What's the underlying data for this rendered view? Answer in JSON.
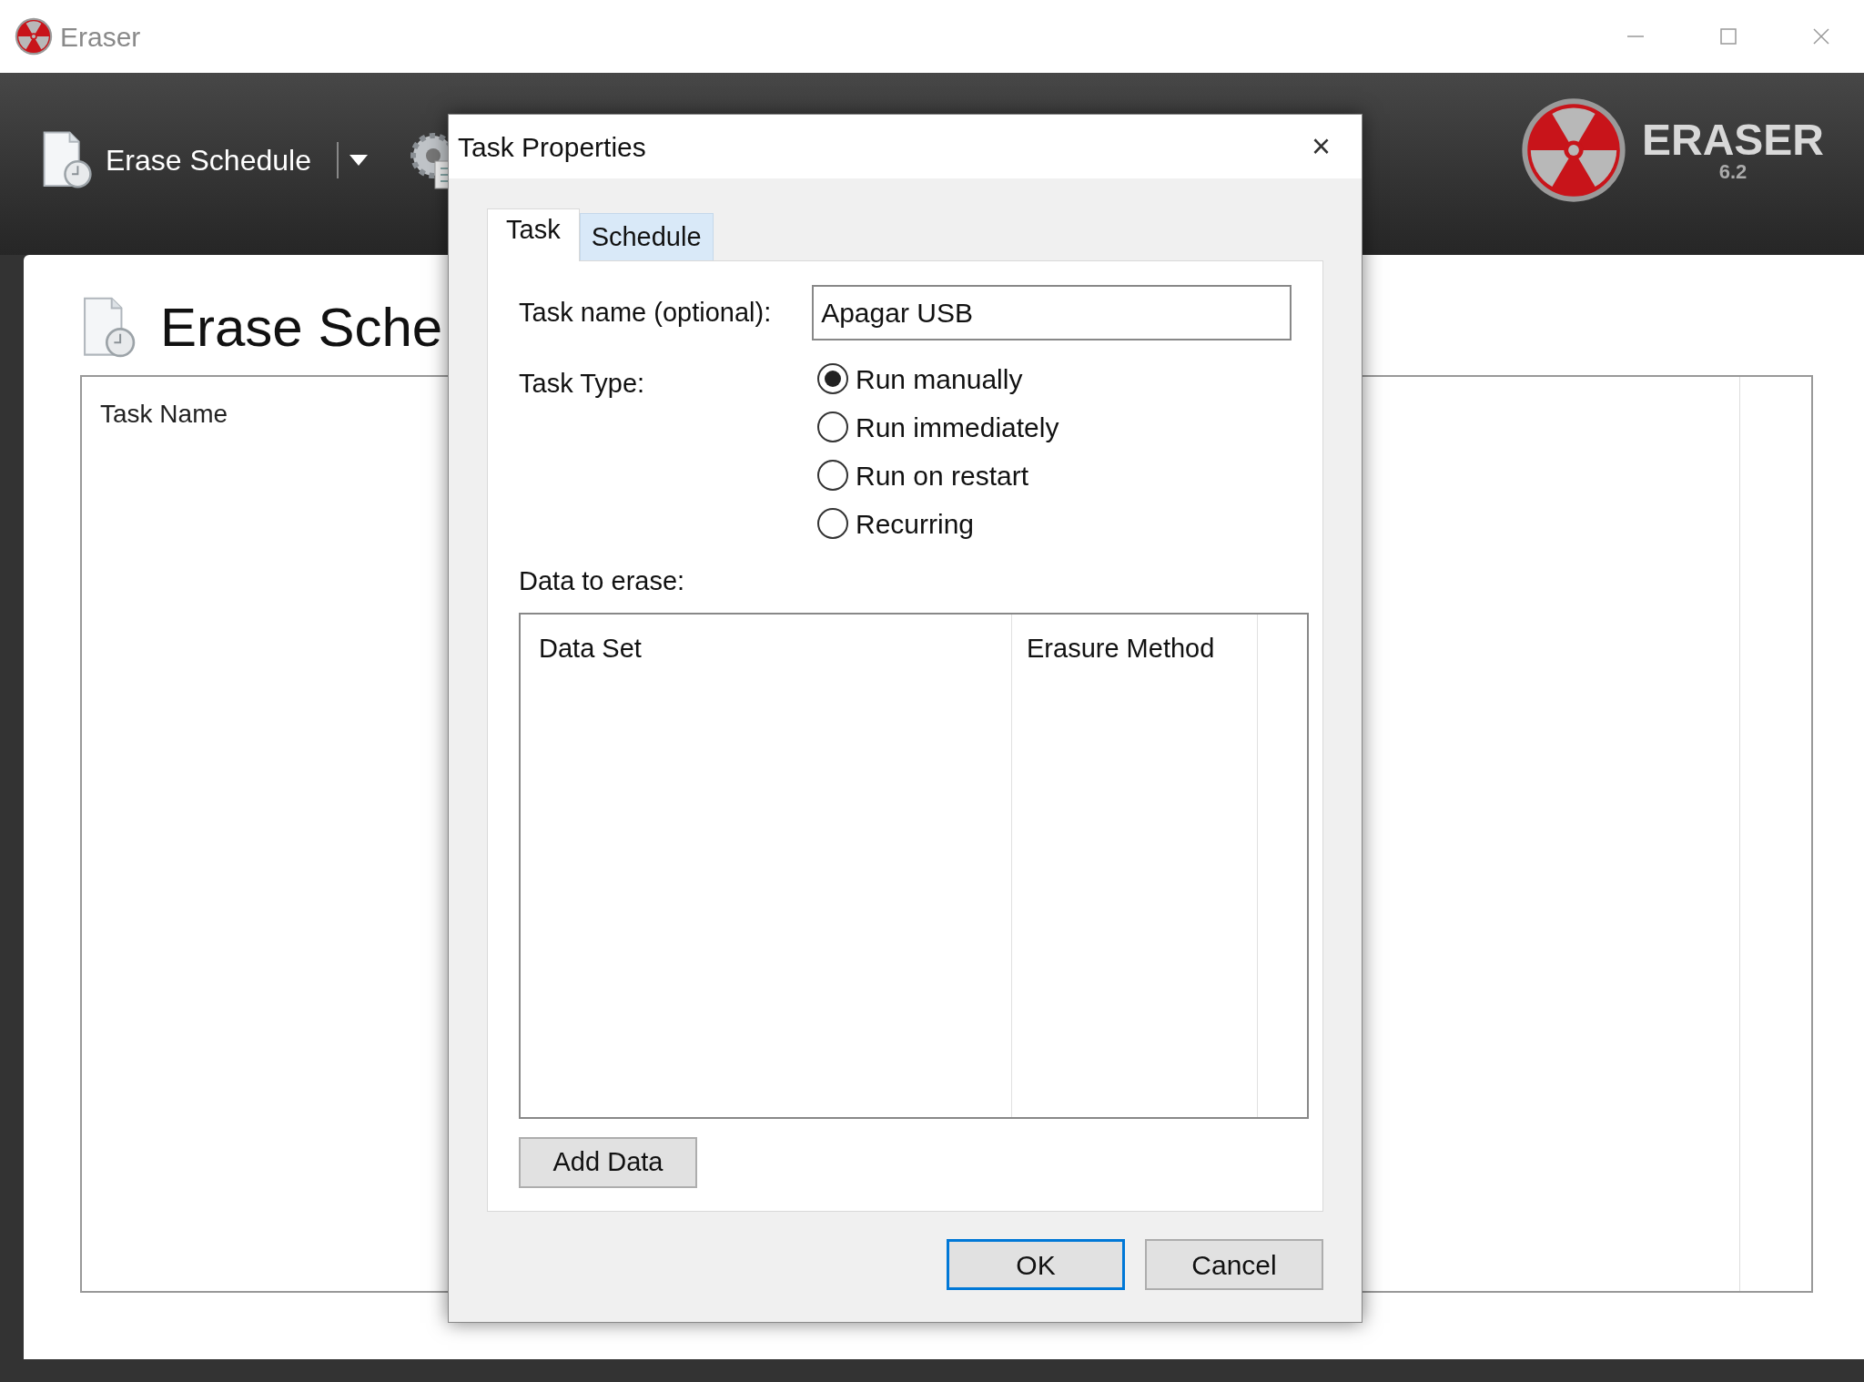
{
  "window": {
    "title": "Eraser"
  },
  "toolbar": {
    "items": [
      {
        "label": "Erase Schedule"
      }
    ]
  },
  "logo": {
    "name": "ERASER",
    "version": "6.2"
  },
  "page": {
    "heading": "Erase Sche",
    "columns": [
      "Task Name"
    ]
  },
  "dialog": {
    "title": "Task Properties",
    "close": "×",
    "tabs": [
      {
        "label": "Task",
        "selected": true
      },
      {
        "label": "Schedule",
        "selected": false
      }
    ],
    "task_name": {
      "label": "Task name (optional):",
      "value": "Apagar USB"
    },
    "task_type": {
      "label": "Task Type:",
      "options": [
        {
          "label": "Run manually",
          "selected": true
        },
        {
          "label": "Run immediately",
          "selected": false
        },
        {
          "label": "Run on restart",
          "selected": false
        },
        {
          "label": "Recurring",
          "selected": false
        }
      ]
    },
    "data": {
      "label": "Data to erase:",
      "columns": [
        "Data Set",
        "Erasure Method"
      ]
    },
    "add_button": "Add Data",
    "buttons": [
      {
        "label": "OK",
        "default": true
      },
      {
        "label": "Cancel",
        "default": false
      }
    ]
  }
}
